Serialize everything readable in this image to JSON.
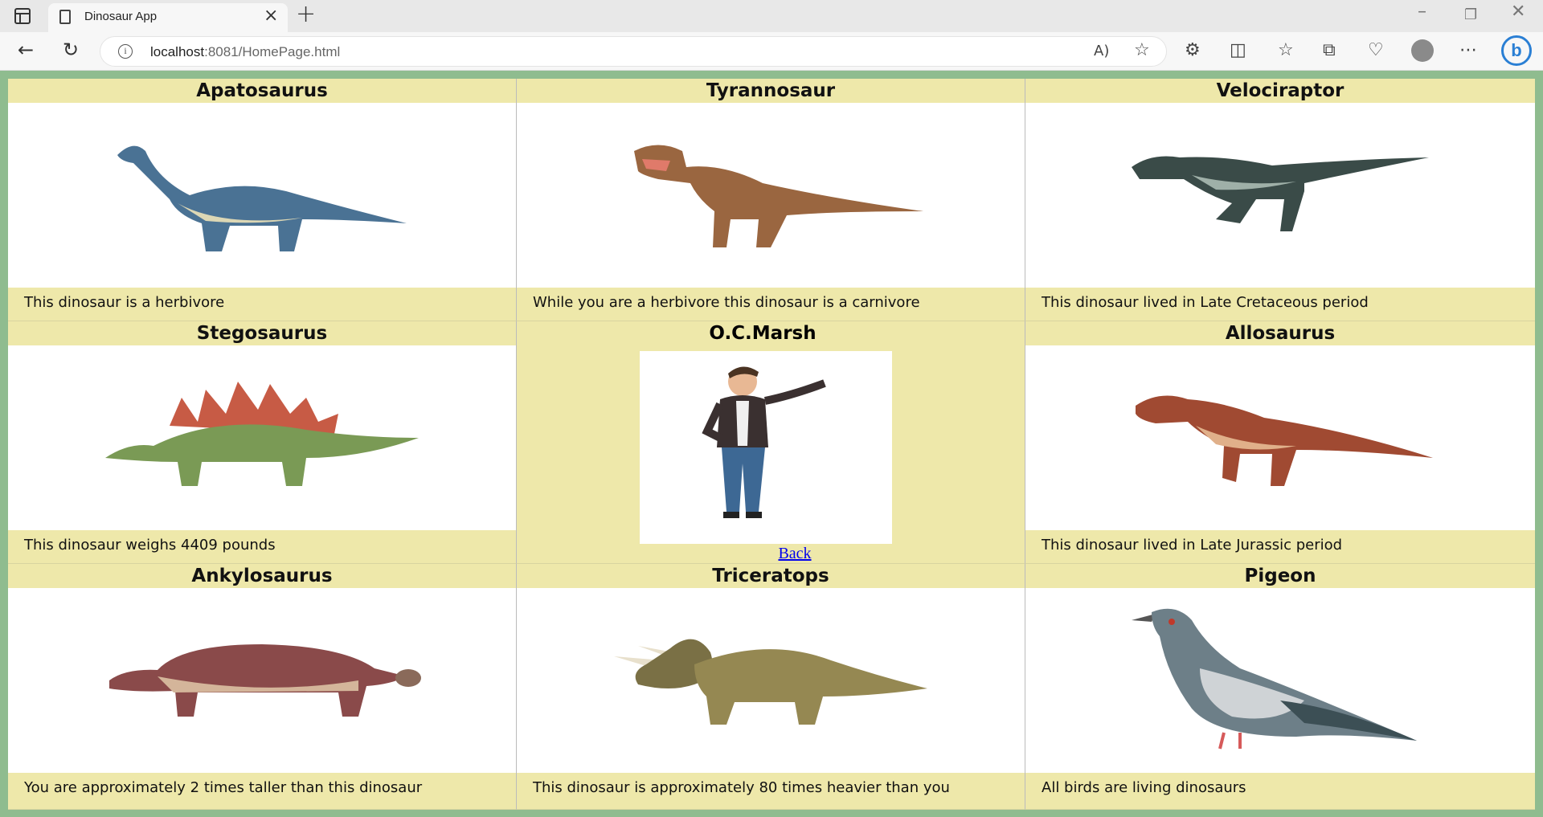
{
  "browser": {
    "tab_title": "Dinosaur App",
    "url_host": "localhost",
    "url_rest": ":8081/HomePage.html"
  },
  "cells": [
    {
      "title": "Apatosaurus",
      "text": "This dinosaur is a herbivore"
    },
    {
      "title": "Tyrannosaur",
      "text": "While you are a herbivore this dinosaur is a carnivore"
    },
    {
      "title": "Velociraptor",
      "text": "This dinosaur lived in Late Cretaceous period"
    },
    {
      "title": "Stegosaurus",
      "text": "This dinosaur weighs 4409 pounds"
    },
    {
      "title": "O.C.Marsh",
      "link": "Back"
    },
    {
      "title": "Allosaurus",
      "text": "This dinosaur lived in Late Jurassic period"
    },
    {
      "title": "Ankylosaurus",
      "text": "You are approximately 2 times taller than this dinosaur"
    },
    {
      "title": "Triceratops",
      "text": "This dinosaur is approximately 80 times heavier than you"
    },
    {
      "title": "Pigeon",
      "text": "All birds are living dinosaurs"
    }
  ],
  "colors": {
    "page_bg": "#8fbc8f",
    "cell_bg": "#eee8aa",
    "link": "#0000ee"
  }
}
